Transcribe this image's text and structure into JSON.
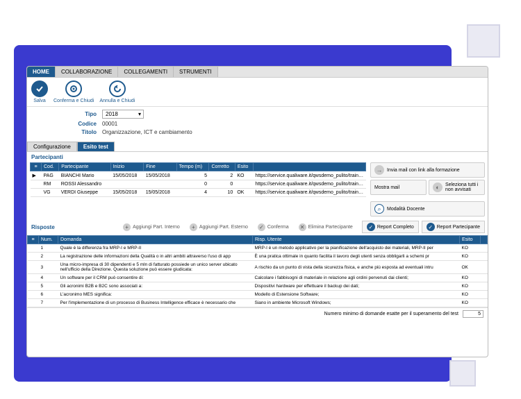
{
  "mainTabs": [
    "HOME",
    "COLLABORAZIONE",
    "COLLEGAMENTI",
    "STRUMENTI"
  ],
  "toolbar": {
    "salva": "Salva",
    "conferma": "Conferma e Chiudi",
    "annulla": "Annulla e Chiudi"
  },
  "form": {
    "tipoLabel": "Tipo",
    "tipoVal": "2018",
    "codiceLabel": "Codice",
    "codiceVal": "00001",
    "titoloLabel": "Titolo",
    "titoloVal": "Organizzazione, ICT e cambiamento"
  },
  "subTabs": [
    "Configurazione",
    "Esito test"
  ],
  "partTitle": "Partecipanti",
  "partCols": {
    "cod": "Cod.",
    "part": "Partecipante",
    "inizio": "Inizio",
    "fine": "Fine",
    "tempo": "Tempo (m)",
    "corretto": "Corretto",
    "esito": "Esito"
  },
  "partRows": [
    {
      "cod": "PAG",
      "part": "BIANCHI Mario",
      "inizio": "15/05/2018",
      "fine": "15/05/2018",
      "tempo": "5",
      "corretto": "2",
      "esito": "KO",
      "url": "https://service.qualiware.it/qwsdemo_pulito/traininguser.aspx?TRA"
    },
    {
      "cod": "RM",
      "part": "ROSSI Alessandro",
      "inizio": "",
      "fine": "",
      "tempo": "0",
      "corretto": "0",
      "esito": "",
      "url": "https://service.qualiware.it/qwsdemo_pulito/traininguser.aspx?TRA"
    },
    {
      "cod": "VG",
      "part": "VERDI Giuseppe",
      "inizio": "15/05/2018",
      "fine": "15/05/2018",
      "tempo": "4",
      "corretto": "10",
      "esito": "OK",
      "url": "https://service.qualiware.it/qwsdemo_pulito/traininguser.aspx?TRA"
    }
  ],
  "sideBtns": {
    "invia": "Invia mail con link alla formazione",
    "mostra": "Mostra mail",
    "seleziona": "Seleziona tutti i non avvisati",
    "docente": "Modalità Docente"
  },
  "actions": {
    "aggInt": "Aggiungi Part. Interno",
    "aggExt": "Aggiungi Part. Esterno",
    "conferma": "Conferma",
    "elimina": "Elimina Partecipante"
  },
  "reports": {
    "completo": "Report Completo",
    "partecipante": "Report Partecipante"
  },
  "rispTitle": "Risposte",
  "rispCols": {
    "num": "Num.",
    "domanda": "Domanda",
    "risp": "Risp. Utente",
    "esito": "Esito"
  },
  "rispRows": [
    {
      "n": "1",
      "d": "Quale è la differenza fra MRP-I e MRP-II",
      "r": "MRP-I è un metodo applicativo per la pianificazione dell'acquisto dei materiali, MRP-II per",
      "e": "KO"
    },
    {
      "n": "2",
      "d": "La registrazione delle informazioni della Qualità o in altri ambiti attraverso l'uso di app",
      "r": "È una pratica ottimale in quanto facilita il lavoro degli utenti senza obbligarli a schemi pr",
      "e": "KO"
    },
    {
      "n": "3",
      "d": "Una micro-impresa di 30 dipendenti e 5 mln di fatturato possiede un unico server ubicato nell'ufficio della Direzione. Questa soluzione può essere giudicata:",
      "r": "A rischio da un punto di vista della sicurezza fisica, e anche più esposta ad eventuali intru",
      "e": "OK"
    },
    {
      "n": "4",
      "d": "Un software per il CRM può consentire di:",
      "r": "Calcolare i fabbisogni di materiale in relazione agli ordini pervenuti dai clienti;",
      "e": "KO"
    },
    {
      "n": "5",
      "d": "Gli acronimi B2B e B2C sono associati a:",
      "r": "Dispositivi hardware per effettuare il backup dei dati;",
      "e": "KO"
    },
    {
      "n": "6",
      "d": "L'acronimo MES significa:",
      "r": "Modello di Estensione Software;",
      "e": "KO"
    },
    {
      "n": "7",
      "d": "Per l'implementazione di un processo di Business Intelligence efficace è necessario che",
      "r": "Siano in ambiente Microsoft Windows;",
      "e": "KO"
    }
  ],
  "footer": {
    "label": "Numero minimo di domande esatte per il superamento del test",
    "val": "5"
  }
}
